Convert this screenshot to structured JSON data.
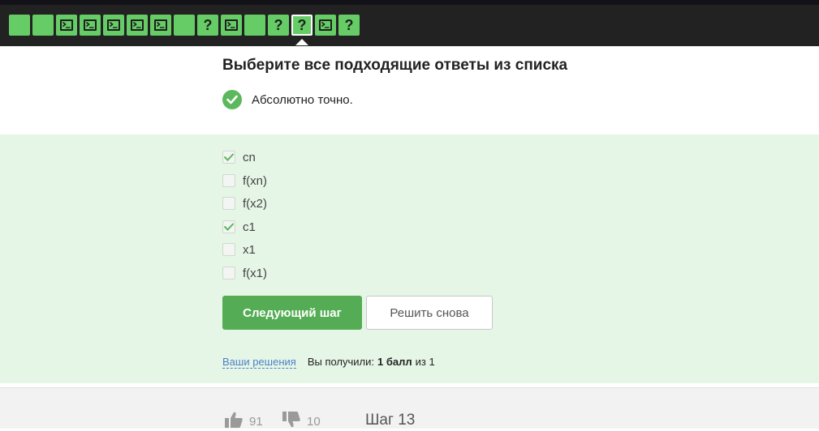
{
  "step_nav": {
    "steps": [
      {
        "type": "text",
        "label": ""
      },
      {
        "type": "text",
        "label": ""
      },
      {
        "type": "code",
        "label": ""
      },
      {
        "type": "code",
        "label": ""
      },
      {
        "type": "code",
        "label": ""
      },
      {
        "type": "code",
        "label": ""
      },
      {
        "type": "code",
        "label": ""
      },
      {
        "type": "text",
        "label": ""
      },
      {
        "type": "quiz",
        "label": "?"
      },
      {
        "type": "code",
        "label": ""
      },
      {
        "type": "text",
        "label": ""
      },
      {
        "type": "quiz",
        "label": "?"
      },
      {
        "type": "quiz",
        "label": "?",
        "active": true
      },
      {
        "type": "code",
        "label": ""
      },
      {
        "type": "quiz",
        "label": "?"
      }
    ],
    "passed_color": "#66cc66"
  },
  "question": {
    "title": "Выберите все подходящие ответы из списка"
  },
  "feedback": {
    "text": "Абсолютно точно.",
    "icon": "check-circle-icon",
    "color": "#5cb85c"
  },
  "options": [
    {
      "label": "cn",
      "checked": true
    },
    {
      "label": "f(xn)",
      "checked": false
    },
    {
      "label": "f(x2)",
      "checked": false
    },
    {
      "label": "c1",
      "checked": true
    },
    {
      "label": "x1",
      "checked": false
    },
    {
      "label": "f(x1)",
      "checked": false
    }
  ],
  "buttons": {
    "next": "Следующий шаг",
    "retry": "Решить снова"
  },
  "result": {
    "solutions_link": "Ваши решения",
    "prefix": "Вы получили:",
    "score": "1 балл",
    "suffix": "из 1"
  },
  "footer": {
    "likes": "91",
    "dislikes": "10",
    "step_label": "Шаг 13"
  }
}
